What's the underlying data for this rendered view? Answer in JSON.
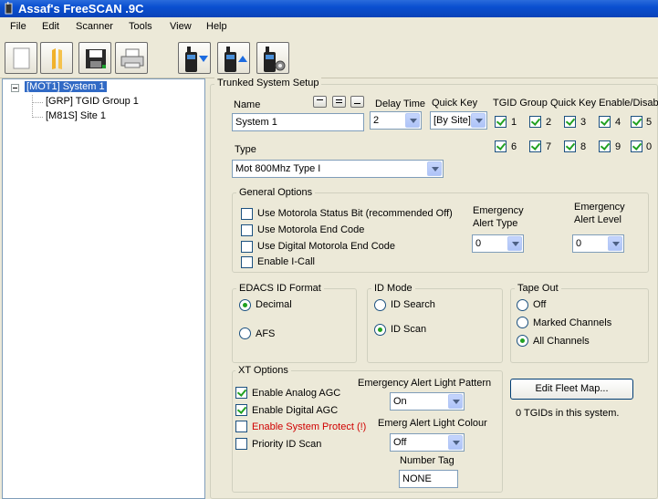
{
  "window": {
    "title": "Assaf's FreeSCAN .9C"
  },
  "menu": [
    "File",
    "Edit",
    "Scanner",
    "Tools",
    "View",
    "Help"
  ],
  "toolbar": {
    "icons": [
      "new-icon",
      "open-icon",
      "save-icon",
      "print-icon",
      "read-from-scanner-icon",
      "write-to-scanner-icon",
      "scanner-settings-icon"
    ]
  },
  "tree": {
    "root": "[MOT1] System 1",
    "children": [
      "[GRP] TGID Group 1",
      "[M81S] Site 1"
    ]
  },
  "panel": {
    "title": "Trunked System Setup",
    "name_label": "Name",
    "name_value": "System 1",
    "delay_label": "Delay Time",
    "delay_value": "2",
    "quickkey_label": "Quick Key",
    "quickkey_value": "[By Site]",
    "tgid_label": "TGID Group Quick Key Enable/Disable",
    "tgid_checks": [
      {
        "label": "1",
        "checked": true
      },
      {
        "label": "2",
        "checked": true
      },
      {
        "label": "3",
        "checked": true
      },
      {
        "label": "4",
        "checked": true
      },
      {
        "label": "5",
        "checked": true
      },
      {
        "label": "6",
        "checked": true
      },
      {
        "label": "7",
        "checked": true
      },
      {
        "label": "8",
        "checked": true
      },
      {
        "label": "9",
        "checked": true
      },
      {
        "label": "0",
        "checked": true
      }
    ],
    "type_label": "Type",
    "type_value": "Mot 800Mhz Type I"
  },
  "general": {
    "title": "General Options",
    "options": [
      {
        "label": "Use Motorola Status Bit (recommended Off)",
        "checked": false
      },
      {
        "label": "Use Motorola End Code",
        "checked": false
      },
      {
        "label": "Use Digital  Motorola End Code",
        "checked": false
      },
      {
        "label": "Enable I-Call",
        "checked": false
      }
    ],
    "alert_type_label_1": "Emergency",
    "alert_type_label_2": "Alert Type",
    "alert_type_value": "0",
    "alert_level_label_1": "Emergency",
    "alert_level_label_2": "Alert Level",
    "alert_level_value": "0"
  },
  "edacs": {
    "title": "EDACS ID Format",
    "options": [
      {
        "label": "Decimal",
        "selected": true
      },
      {
        "label": "AFS",
        "selected": false
      }
    ]
  },
  "idmode": {
    "title": "ID Mode",
    "options": [
      {
        "label": "ID Search",
        "selected": false
      },
      {
        "label": "ID Scan",
        "selected": true
      }
    ]
  },
  "tapeout": {
    "title": "Tape Out",
    "options": [
      {
        "label": "Off",
        "selected": false
      },
      {
        "label": "Marked Channels",
        "selected": false
      },
      {
        "label": "All Channels",
        "selected": true
      }
    ]
  },
  "xt": {
    "title": "XT  Options",
    "options": [
      {
        "label": "Enable Analog AGC",
        "checked": true
      },
      {
        "label": "Enable Digital AGC",
        "checked": true
      },
      {
        "label": "Enable System Protect (!)",
        "checked": false
      },
      {
        "label": "Priority ID Scan",
        "checked": false
      }
    ],
    "light_pattern_label": "Emergency Alert Light Pattern",
    "light_pattern_value": "On",
    "light_colour_label": "Emerg Alert Light Colour",
    "light_colour_value": "Off",
    "number_tag_label": "Number Tag",
    "number_tag_value": "NONE"
  },
  "fleet": {
    "button_label": "Edit Fleet Map...",
    "status": "0 TGIDs in this system."
  },
  "colors": {
    "titlebar": "#0a4fd0",
    "selection": "#316ac5",
    "warning": "#d00000",
    "check": "#21a121"
  }
}
